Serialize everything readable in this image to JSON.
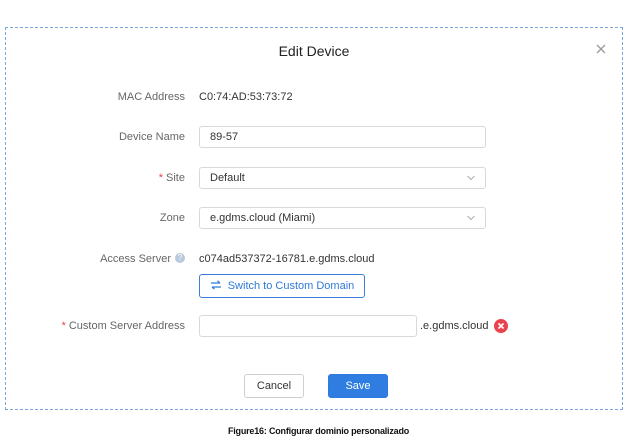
{
  "dialog": {
    "title": "Edit Device"
  },
  "fields": {
    "mac_label": "MAC Address",
    "mac_value": "C0:74:AD:53:73:72",
    "device_name_label": "Device Name",
    "device_name_value": "89-57",
    "site_required_mark": "*",
    "site_label": "Site",
    "site_value": "Default",
    "zone_label": "Zone",
    "zone_value": "e.gdms.cloud (Miami)",
    "access_server_label": "Access Server",
    "access_server_value": "c074ad537372-16781.e.gdms.cloud",
    "switch_button_label": "Switch to Custom Domain",
    "custom_required_mark": "*",
    "custom_server_label": "Custom Server Address",
    "custom_server_value": "",
    "custom_server_suffix": ".e.gdms.cloud"
  },
  "footer": {
    "cancel_label": "Cancel",
    "save_label": "Save"
  },
  "caption": "Figure16: Configurar dominio personalizado",
  "colors": {
    "accent": "#2f7de1",
    "required": "#e0474d",
    "clear": "#e9434f"
  }
}
